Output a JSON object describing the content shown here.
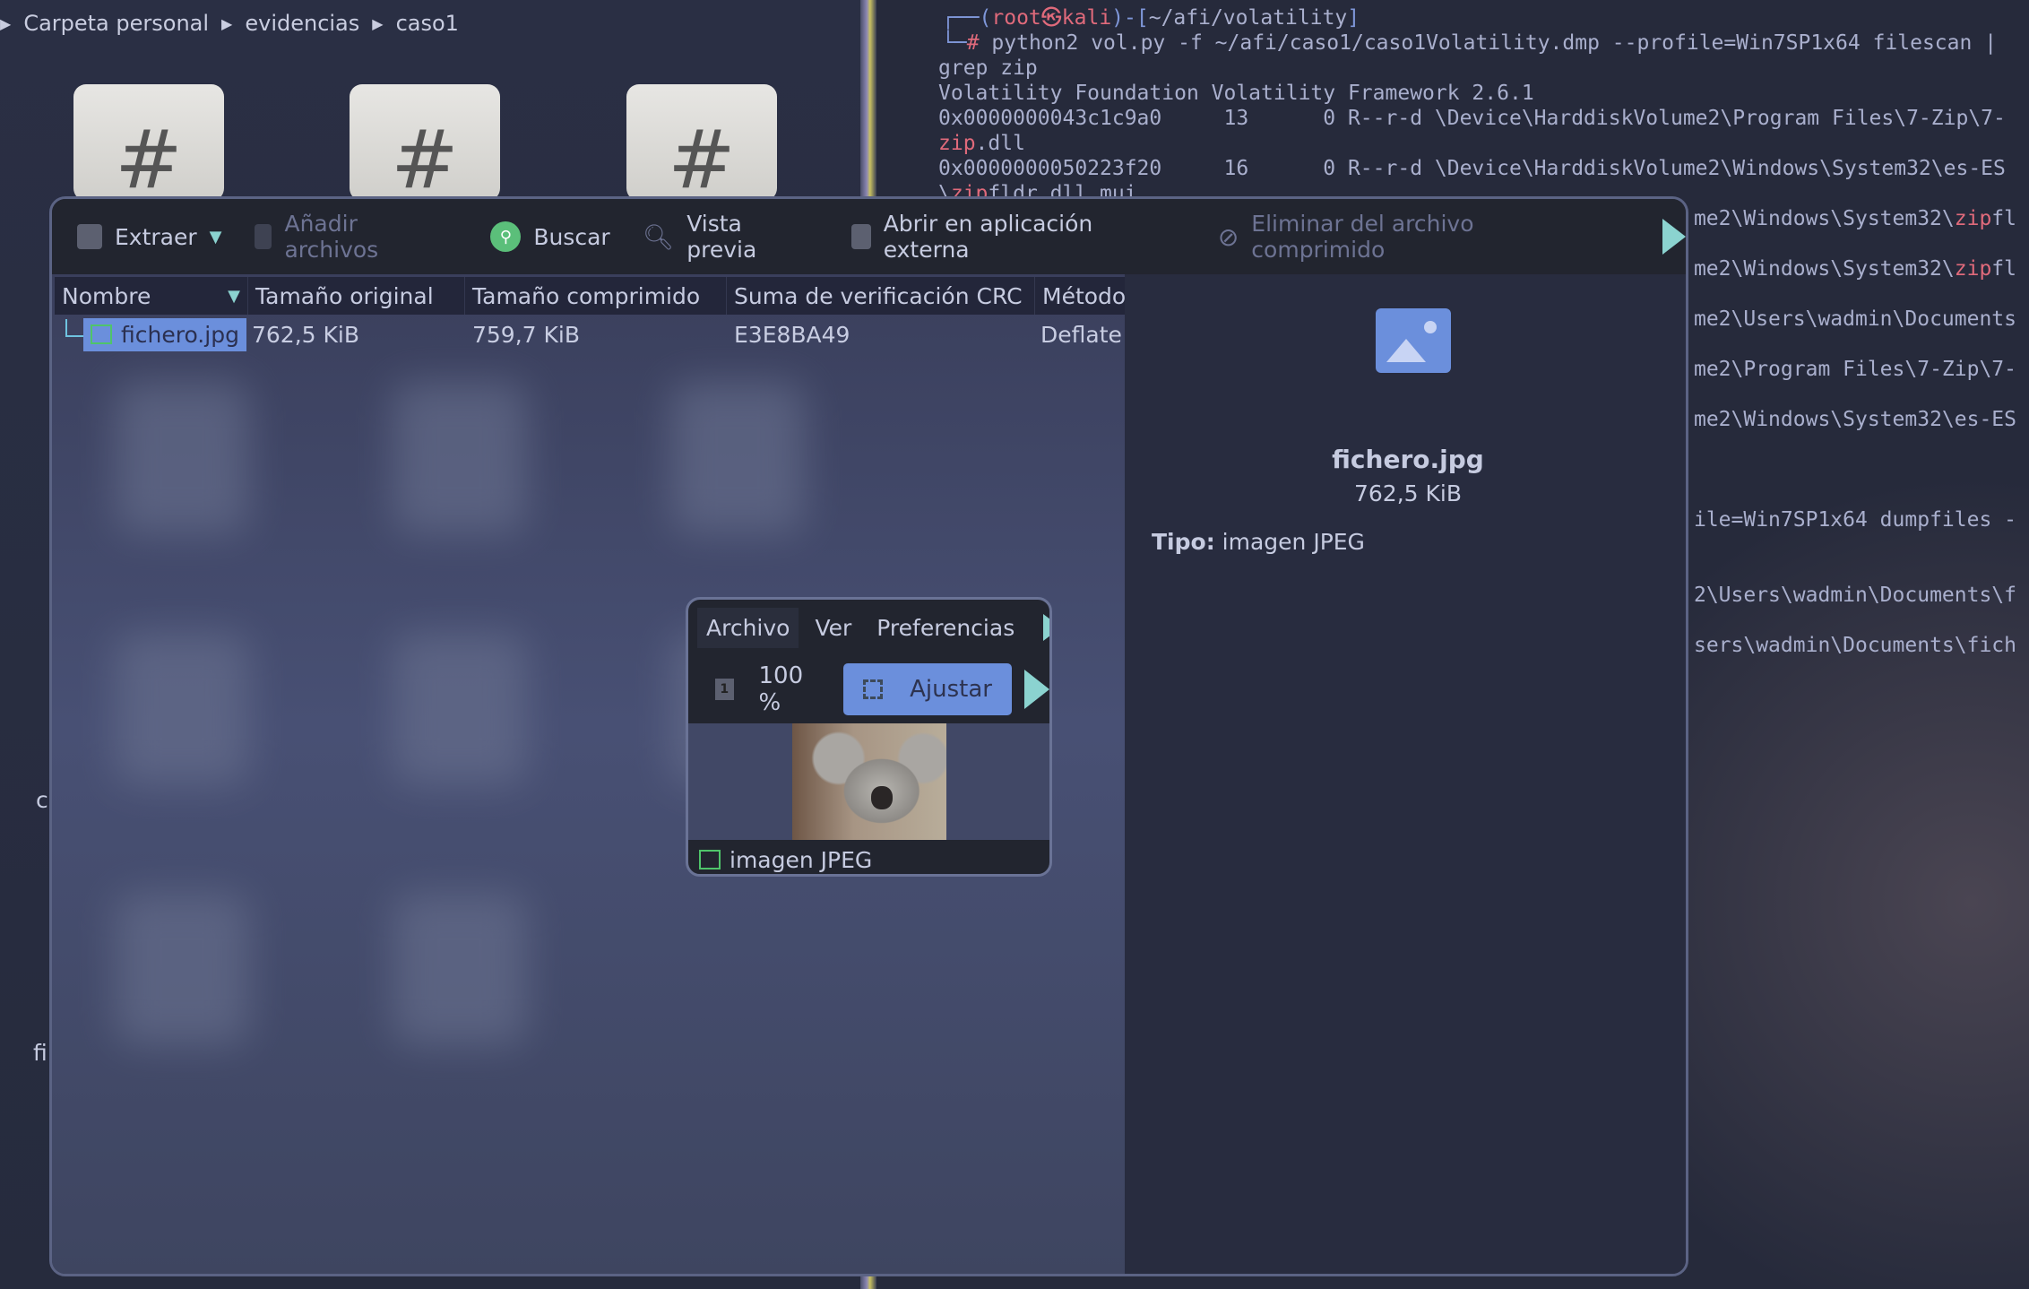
{
  "breadcrumb": [
    "Carpeta personal",
    "evidencias",
    "caso1"
  ],
  "desktop_partial_labels": [
    "c",
    "fi"
  ],
  "terminal": {
    "prompt_user": "root",
    "prompt_host": "kali",
    "prompt_path": "~/afi/volatility",
    "command": "python2 vol.py -f ~/afi/caso1/caso1Volatility.dmp --profile=Win7SP1x64 filescan |",
    "command_cont": "grep zip",
    "banner": "Volatility Foundation Volatility Framework 2.6.1",
    "line1": "0x0000000043c1c9a0     13      0 R--r-d \\Device\\HarddiskVolume2\\Program Files\\7-Zip\\7-",
    "line1b_match": "zip",
    "line1b_rest": ".dll",
    "line2": "0x0000000050223f20     16      0 R--r-d \\Device\\HarddiskVolume2\\Windows\\System32\\es-ES",
    "line2b_pre": "\\",
    "line2b_match": "zip",
    "line2b_rest": "fldr.dll.mui",
    "fragments": [
      {
        "pre": "me2\\Windows\\System32\\",
        "match": "zip",
        "post": "fl"
      },
      {
        "pre": "me2\\Windows\\System32\\",
        "match": "zip",
        "post": "fl"
      },
      {
        "pre": "me2\\Users\\wadmin\\Documents",
        "match": "",
        "post": ""
      },
      {
        "pre": "me2\\Program Files\\7-Zip\\7-",
        "match": "",
        "post": ""
      },
      {
        "pre": "me2\\Windows\\System32\\es-ES",
        "match": "",
        "post": ""
      },
      {
        "pre": "ile=Win7SP1x64 dumpfiles -",
        "match": "",
        "post": ""
      },
      {
        "pre": "2\\Users\\wadmin\\Documents\\f",
        "match": "",
        "post": ""
      },
      {
        "pre": "sers\\wadmin\\Documents\\fich",
        "match": "",
        "post": ""
      }
    ]
  },
  "ark": {
    "toolbar": {
      "extract": "Extraer",
      "add": "Añadir archivos",
      "search": "Buscar",
      "preview": "Vista previa",
      "open_external": "Abrir en aplicación externa",
      "delete": "Eliminar del archivo comprimido"
    },
    "columns": [
      "Nombre",
      "Tamaño original",
      "Tamaño comprimido",
      "Suma de verificación CRC",
      "Método"
    ],
    "rows": [
      {
        "name": "fichero.jpg",
        "original": "762,5 KiB",
        "compressed": "759,7 KiB",
        "crc": "E3E8BA49",
        "method": "Deflate"
      }
    ],
    "preview": {
      "name": "fichero.jpg",
      "size": "762,5 KiB",
      "type_label": "Tipo:",
      "type_value": "imagen JPEG"
    }
  },
  "viewer": {
    "menu": [
      "Archivo",
      "Ver",
      "Preferencias"
    ],
    "zoom": "100 %",
    "fit": "Ajustar",
    "status": "imagen JPEG"
  },
  "colors": {
    "accent": "#6b8fdc",
    "match": "#e06a7b",
    "search_green": "#5bbf7a",
    "arrow": "#8bd3d0"
  }
}
